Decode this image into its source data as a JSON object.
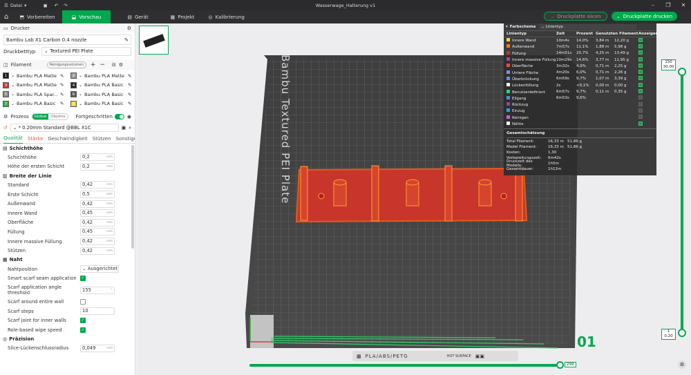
{
  "titlebar": {
    "menu": "Datei",
    "title": "Wasserwage_Halterung v1"
  },
  "tabs": [
    {
      "label": "Vorbereiten"
    },
    {
      "label": "Vorschau"
    },
    {
      "label": "Gerät"
    },
    {
      "label": "Projekt"
    },
    {
      "label": "Kalibrierung"
    }
  ],
  "actions": {
    "slice": "Druckplatte slicen",
    "print": "Druckplatte drucken"
  },
  "printer": {
    "section": "Drucker",
    "name": "Bambu Lab X1 Carbon 0.4 nozzle",
    "bed_label": "Druckbetttyp",
    "bed_value": "Textured PEI Plate"
  },
  "filament": {
    "section": "Filament",
    "flush_button": "Reinigungsvolumen",
    "items": [
      {
        "num": "1",
        "color": "#1a1a1a",
        "name": "Bambu PLA Matte"
      },
      {
        "num": "2",
        "color": "#9a9a9a",
        "name": "Bambu PLA Matte"
      },
      {
        "num": "3",
        "color": "#d23a2e",
        "name": "Bambu PLA Matte"
      },
      {
        "num": "4",
        "color": "#2a2a2a",
        "name": "Bambu PLA Basic"
      },
      {
        "num": "5",
        "color": "#8a8a8a",
        "name": "Bambu PLA Spar..."
      },
      {
        "num": "6",
        "color": "#5a5a6a",
        "name": "Bambu PLA Basic"
      },
      {
        "num": "7",
        "color": "#2fb54a",
        "name": "Bambu PLA Basic"
      },
      {
        "num": "8",
        "color": "#f2d81a",
        "name": "Bambu PLA Basic"
      }
    ]
  },
  "process": {
    "section": "Prozess",
    "toggle_global": "Global",
    "toggle_objects": "Objekte",
    "advanced": "Fortgeschritten",
    "profile": "* 0.20mm Standard @BBL X1C",
    "tabs": [
      "Qualität",
      "Stärke",
      "Geschwindigkeit",
      "Stützen",
      "Sonstige"
    ]
  },
  "groups": {
    "layer_height": {
      "title": "Schichthöhe",
      "rows": [
        {
          "label": "Schichthöhe",
          "value": "0,2",
          "unit": "mm"
        },
        {
          "label": "Höhe der ersten Schicht",
          "value": "0,2",
          "unit": "mm"
        }
      ]
    },
    "line_width": {
      "title": "Breite der Linie",
      "rows": [
        {
          "label": "Standard",
          "value": "0,42",
          "unit": "mm"
        },
        {
          "label": "Erste Schicht",
          "value": "0,5",
          "unit": "mm"
        },
        {
          "label": "Außenwand",
          "value": "0,42",
          "unit": "mm"
        },
        {
          "label": "Innere Wand",
          "value": "0,45",
          "unit": "mm"
        },
        {
          "label": "Oberfläche",
          "value": "0,42",
          "unit": "mm"
        },
        {
          "label": "Füllung",
          "value": "0,45",
          "unit": "mm"
        },
        {
          "label": "Innere massive Füllung",
          "value": "0,42",
          "unit": "mm"
        },
        {
          "label": "Stützen",
          "value": "0,42",
          "unit": "mm"
        }
      ]
    },
    "seam": {
      "title": "Naht",
      "position_label": "Nahtposition",
      "position_value": "Ausgerichtet",
      "smart_scarf": "Smart scarf seam application",
      "angle_label_1": "Scarf application angle",
      "angle_label_2": "threshold",
      "angle_value": "155",
      "around_wall": "Scarf around entire wall",
      "steps_label": "Scarf steps",
      "steps_value": "10",
      "inner_walls": "Scarf joint for inner walls",
      "wipe_speed": "Role-based wipe speed"
    },
    "precision": {
      "title": "Präzision",
      "gap_label": "Slice-Lückenschlussradius",
      "gap_value": "0,049",
      "gap_unit": "mm"
    }
  },
  "viewport": {
    "plate_label": "Bambu Textured PEI Plate",
    "plate_number": "01",
    "plate_footer": "PLA/ABS/PETG",
    "hot_surface": "HOT SURFACE",
    "layer_top_1": "150",
    "layer_top_2": "30.00",
    "layer_bottom_1": "1",
    "layer_bottom_2": "0.20",
    "progress_value": "299"
  },
  "legend": {
    "scheme_label": "Farbschema",
    "scheme_value": "Linientyp",
    "headers": {
      "type": "Linientyp",
      "time": "Zeit",
      "percent": "Prozent",
      "used": "Genutzten Filament",
      "show": "Anzeigen"
    },
    "rows": [
      {
        "color": "#f2d24a",
        "type": "Innere Wand",
        "time": "10m4s",
        "percent": "14,0%",
        "length": "3,84 m",
        "weight": "12,20 g",
        "show": true
      },
      {
        "color": "#ff7a1a",
        "type": "Außenwand",
        "time": "7m57s",
        "percent": "11,1%",
        "length": "1,88 m",
        "weight": "5,98 g",
        "show": true
      },
      {
        "color": "#c0392b",
        "type": "Füllung",
        "time": "14m51s",
        "percent": "20,7%",
        "length": "4,25 m",
        "weight": "13,49 g",
        "show": true
      },
      {
        "color": "#a04a9a",
        "type": "Innere massive Füllung",
        "time": "10m29s",
        "percent": "14,6%",
        "length": "3,77 m",
        "weight": "11,95 g",
        "show": true
      },
      {
        "color": "#e74c3c",
        "type": "Oberfläche",
        "time": "3m32s",
        "percent": "4,9%",
        "length": "0,71 m",
        "weight": "2,25 g",
        "show": true
      },
      {
        "color": "#7f8cff",
        "type": "Untere Fläche",
        "time": "4m20s",
        "percent": "6,0%",
        "length": "0,71 m",
        "weight": "2,26 g",
        "show": true
      },
      {
        "color": "#5b8ff9",
        "type": "Überbrückung",
        "time": "6m59s",
        "percent": "9,7%",
        "length": "1,07 m",
        "weight": "3,39 g",
        "show": true
      },
      {
        "color": "#ffffff",
        "type": "Lückenfüllung",
        "time": "2s",
        "percent": "<0,1%",
        "length": "0,00 m",
        "weight": "0,00 g",
        "show": true
      },
      {
        "color": "#2fd36a",
        "type": "Benutzerdefiniert",
        "time": "6m57s",
        "percent": "9,7%",
        "length": "0,11 m",
        "weight": "0,35 g",
        "show": true
      },
      {
        "color": "#4f8fd8",
        "type": "Eilgang",
        "time": "6m53s",
        "percent": "9,6%",
        "length": "",
        "weight": "",
        "show": false
      },
      {
        "color": "#8e44ad",
        "type": "Rückzug",
        "time": "",
        "percent": "",
        "length": "",
        "weight": "",
        "show": false
      },
      {
        "color": "#2a9df4",
        "type": "Einzug",
        "time": "",
        "percent": "",
        "length": "",
        "weight": "",
        "show": false
      },
      {
        "color": "#d35bd8",
        "type": "Reinigen",
        "time": "",
        "percent": "",
        "length": "",
        "weight": "",
        "show": false
      },
      {
        "color": "#f5f5f5",
        "type": "Nähte",
        "time": "",
        "percent": "",
        "length": "",
        "weight": "",
        "show": true
      }
    ],
    "summary_title": "Gesamtschätzung",
    "summary": [
      {
        "label": "Total Filament:",
        "v1": "16,33 m",
        "v2": "51,86 g"
      },
      {
        "label": "Model Filament:",
        "v1": "16,33 m",
        "v2": "51,86 g"
      },
      {
        "label": "Kosten:",
        "v1": "1,30",
        "v2": ""
      },
      {
        "label": "Vorbereitungszeit:",
        "v1": "6m42s",
        "v2": ""
      },
      {
        "label": "Druckzeit des Modells:",
        "v1": "1h5m",
        "v2": ""
      },
      {
        "label": "Gesamtdauer:",
        "v1": "1h12m",
        "v2": ""
      }
    ]
  }
}
